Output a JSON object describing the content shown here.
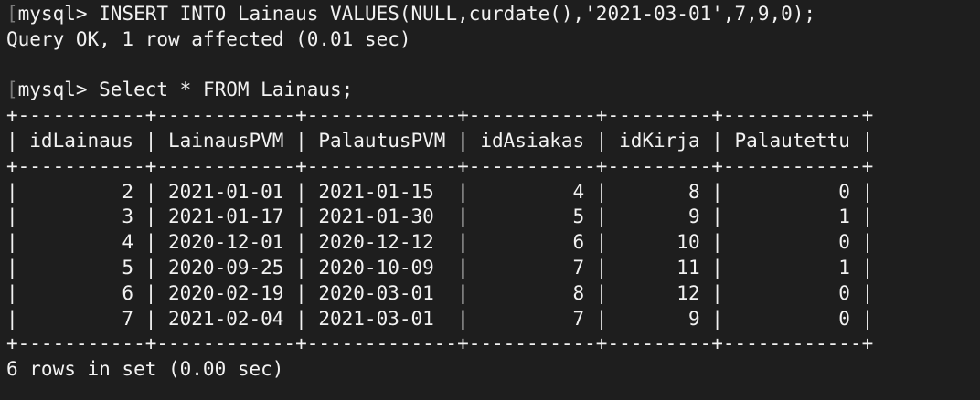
{
  "terminal": {
    "lines": [
      {
        "mark": "[",
        "text": "mysql> INSERT INTO Lainaus VALUES(NULL,curdate(),'2021-03-01',7,9,0);"
      },
      {
        "mark": "",
        "text": "Query OK, 1 row affected (0.01 sec)"
      },
      {
        "mark": "",
        "text": ""
      },
      {
        "mark": "[",
        "text": "mysql> Select * FROM Lainaus;"
      },
      {
        "mark": "",
        "text": "+-----------+------------+-------------+-----------+---------+------------+"
      },
      {
        "mark": "",
        "text": "| idLainaus | LainausPVM | PalautusPVM | idAsiakas | idKirja | Palautettu |"
      },
      {
        "mark": "",
        "text": "+-----------+------------+-------------+-----------+---------+------------+"
      },
      {
        "mark": "",
        "text": "|         2 | 2021-01-01 | 2021-01-15  |         4 |       8 |          0 |"
      },
      {
        "mark": "",
        "text": "|         3 | 2021-01-17 | 2021-01-30  |         5 |       9 |          1 |"
      },
      {
        "mark": "",
        "text": "|         4 | 2020-12-01 | 2020-12-12  |         6 |      10 |          0 |"
      },
      {
        "mark": "",
        "text": "|         5 | 2020-09-25 | 2020-10-09  |         7 |      11 |          1 |"
      },
      {
        "mark": "",
        "text": "|         6 | 2020-02-19 | 2020-03-01  |         8 |      12 |          0 |"
      },
      {
        "mark": "",
        "text": "|         7 | 2021-02-04 | 2021-03-01  |         7 |       9 |          0 |"
      },
      {
        "mark": "",
        "text": "+-----------+------------+-------------+-----------+---------+------------+"
      },
      {
        "mark": "",
        "text": "6 rows in set (0.00 sec)"
      }
    ]
  }
}
